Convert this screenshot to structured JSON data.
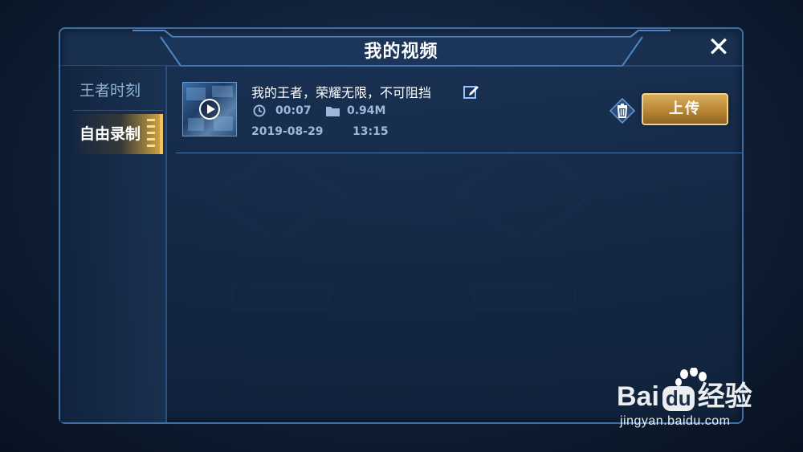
{
  "dialog": {
    "title": "我的视频",
    "close_label": "✕"
  },
  "sidebar": {
    "tabs": [
      {
        "label": "王者时刻",
        "active": false
      },
      {
        "label": "自由录制",
        "active": true
      }
    ]
  },
  "videos": [
    {
      "title": "我的王者，荣耀无限，不可阻挡",
      "duration": "00:07",
      "size": "0.94M",
      "date": "2019-08-29",
      "time": "13:15",
      "upload_label": "上传"
    }
  ],
  "watermark": {
    "brand_prefix": "Bai",
    "brand_suffix": "du",
    "brand_cn": "经验",
    "url": "jingyan.baidu.com"
  },
  "colors": {
    "accent_gold": "#d9ad5e",
    "border_blue": "#3d6fa6",
    "text_muted": "#9db9da"
  }
}
